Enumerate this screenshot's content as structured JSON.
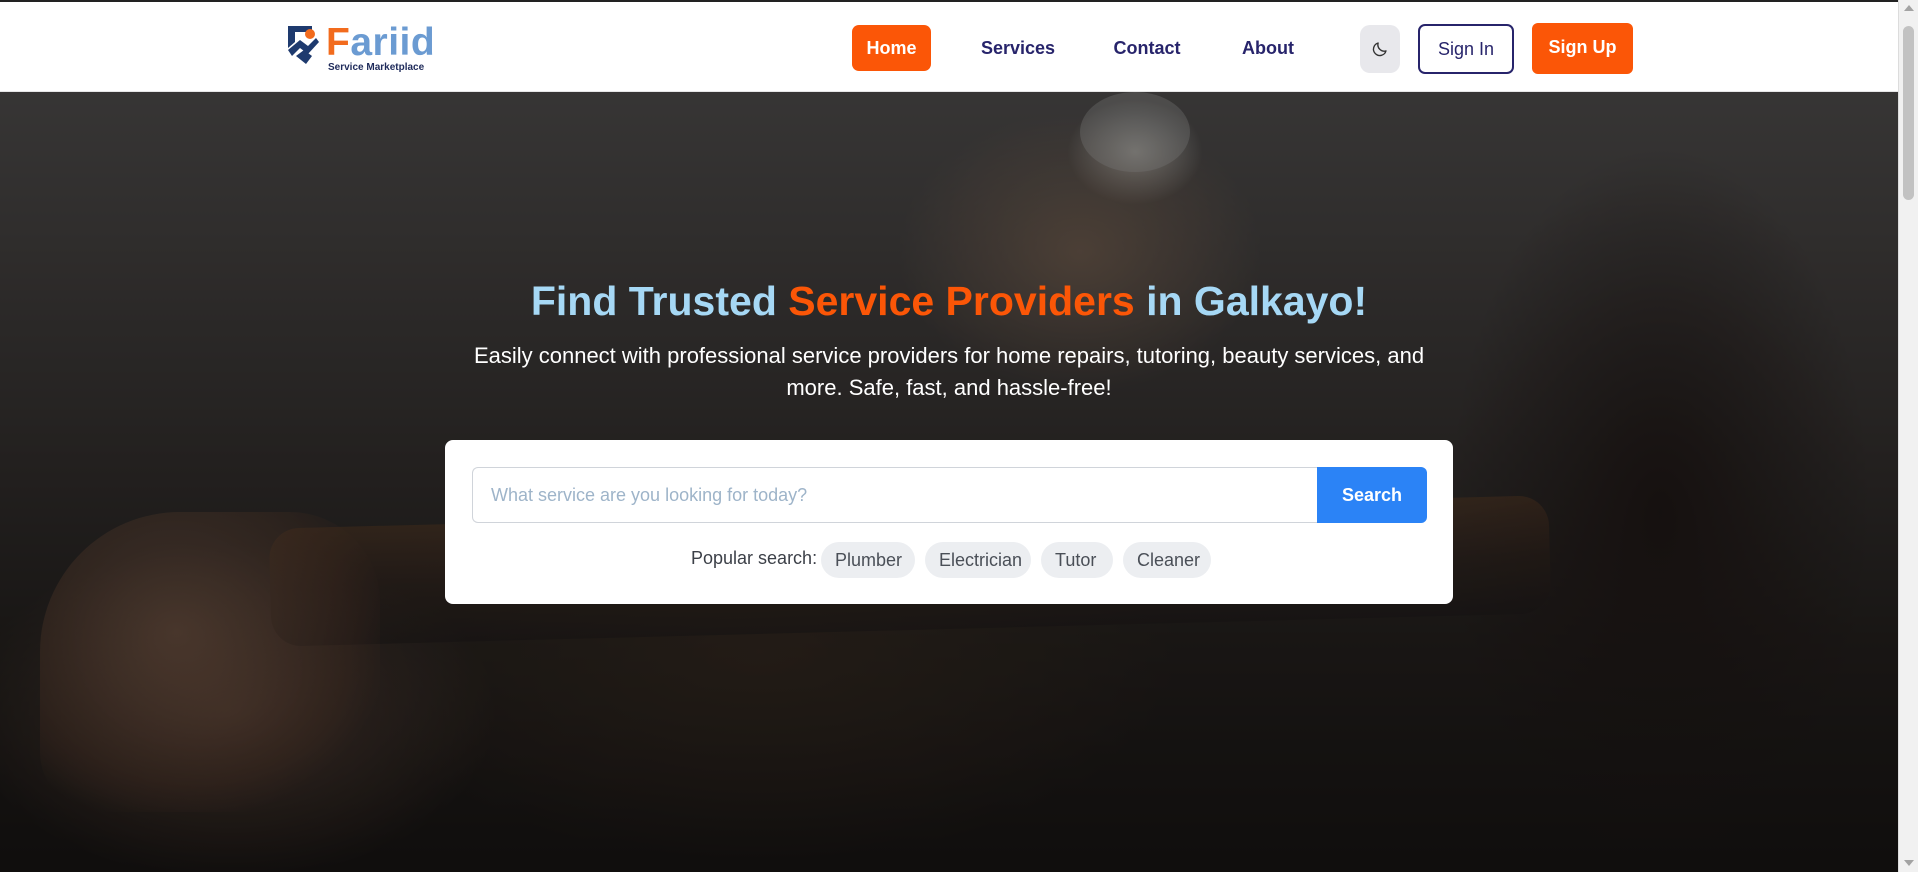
{
  "header": {
    "logo": {
      "first_letter": "F",
      "rest": "ariid",
      "tagline": "Service Marketplace"
    },
    "nav": [
      {
        "label": "Home",
        "active": true
      },
      {
        "label": "Services",
        "active": false
      },
      {
        "label": "Contact",
        "active": false
      },
      {
        "label": "About",
        "active": false
      }
    ],
    "theme_toggle_icon": "moon-icon",
    "sign_in_label": "Sign In",
    "sign_up_label": "Sign Up"
  },
  "hero": {
    "title": {
      "part1": "Find Trusted ",
      "accent": "Service Providers",
      "part2": " in Galkayo!"
    },
    "subtitle": "Easily connect with professional service providers for home repairs, tutoring, beauty services, and more. Safe, fast, and hassle-free!",
    "search": {
      "placeholder": "What service are you looking for today?",
      "value": "",
      "button_label": "Search",
      "popular_label": "Popular search:",
      "popular_tags": [
        "Plumber",
        "Electrician",
        "Tutor",
        "Cleaner"
      ]
    }
  },
  "colors": {
    "accent": "#fb5607",
    "brand_navy": "#27246b",
    "title_light_blue": "#a6d8f5",
    "search_blue": "#2b83f6"
  }
}
